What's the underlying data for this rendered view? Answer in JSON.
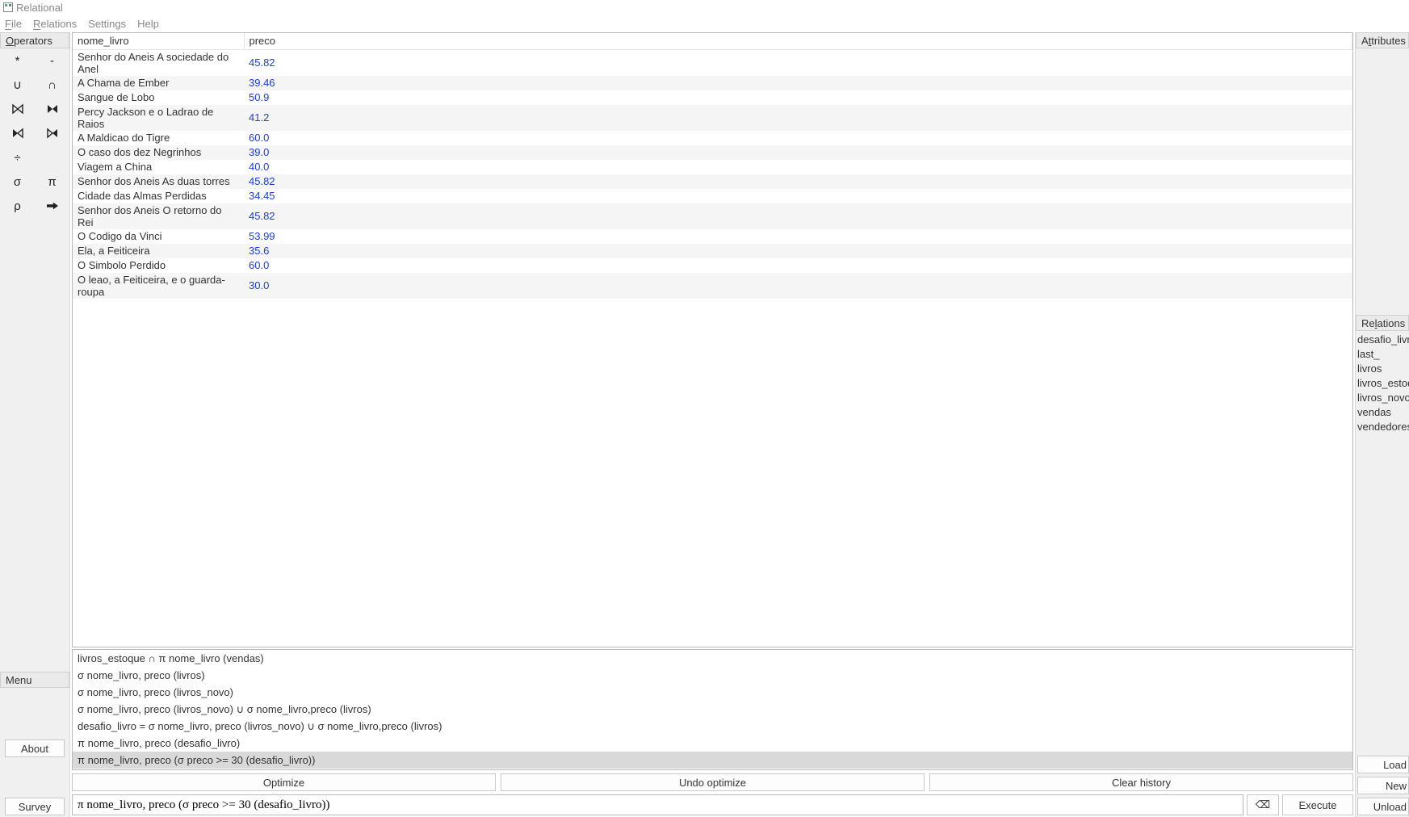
{
  "window": {
    "title": "Relational"
  },
  "menubar": {
    "file": "File",
    "relations": "Relations",
    "settings": "Settings",
    "help": "Help"
  },
  "left_panel": {
    "header": "Operators",
    "ops": [
      "*",
      "-",
      "∪",
      "∩",
      "⋈",
      "⊳⊲",
      "⋉",
      "⋊",
      "÷",
      "",
      "σ",
      "π",
      "ρ",
      "➨"
    ],
    "menu_label": "Menu",
    "about": "About",
    "survey": "Survey"
  },
  "table": {
    "columns": [
      "nome_livro",
      "preco"
    ],
    "rows": [
      [
        "Senhor do Aneis A sociedade do Anel",
        "45.82"
      ],
      [
        "A Chama de Ember",
        "39.46"
      ],
      [
        "Sangue de Lobo",
        "50.9"
      ],
      [
        "Percy Jackson e o Ladrao de Raios",
        "41.2"
      ],
      [
        "A Maldicao do Tigre",
        "60.0"
      ],
      [
        "O caso dos dez Negrinhos",
        "39.0"
      ],
      [
        "Viagem a China",
        "40.0"
      ],
      [
        "Senhor dos Aneis As duas torres",
        "45.82"
      ],
      [
        "Cidade das Almas Perdidas",
        "34.45"
      ],
      [
        "Senhor dos Aneis O retorno do Rei",
        "45.82"
      ],
      [
        "O Codigo da Vinci",
        "53.99"
      ],
      [
        "Ela, a Feiticeira",
        "35.6"
      ],
      [
        "O Simbolo Perdido",
        "60.0"
      ],
      [
        "O leao, a Feiticeira, e o guarda-roupa",
        "30.0"
      ]
    ]
  },
  "history": [
    "livros_estoque ∩ π nome_livro (vendas)",
    "σ nome_livro, preco (livros)",
    "σ nome_livro, preco (livros_novo)",
    "σ nome_livro, preco (livros_novo) ∪ σ nome_livro,preco (livros)",
    "desafio_livro = σ nome_livro, preco (livros_novo) ∪ σ nome_livro,preco (livros)",
    "π nome_livro, preco (desafio_livro)",
    "π nome_livro, preco (σ preco >= 30 (desafio_livro))"
  ],
  "history_selected_index": 6,
  "buttons": {
    "optimize": "Optimize",
    "undo_optimize": "Undo optimize",
    "clear_history": "Clear history",
    "clear_icon": "⌫",
    "execute": "Execute"
  },
  "query_input": "π nome_livro, preco (σ preco >= 30 (desafio_livro))",
  "right_panel": {
    "attributes_header": "Attributes",
    "relations_header": "Relations",
    "relations": [
      "desafio_livro",
      "last_",
      "livros",
      "livros_estoque",
      "livros_novo",
      "vendas",
      "vendedores"
    ],
    "load": "Load",
    "new": "New",
    "unload": "Unload"
  }
}
